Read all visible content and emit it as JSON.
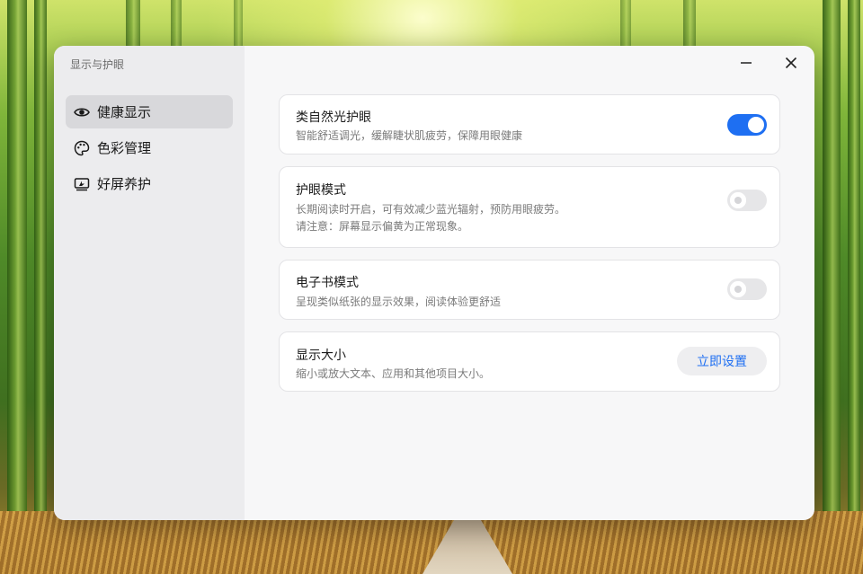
{
  "window": {
    "app_title": "显示与护眼"
  },
  "sidebar": {
    "items": [
      {
        "label": "健康显示",
        "icon": "eye-icon",
        "active": true
      },
      {
        "label": "色彩管理",
        "icon": "palette-icon",
        "active": false
      },
      {
        "label": "好屏养护",
        "icon": "screen-care-icon",
        "active": false
      }
    ]
  },
  "controls": {
    "minimize_icon": "minimize-icon",
    "close_icon": "close-icon"
  },
  "settings": {
    "natural_eye": {
      "title": "类自然光护眼",
      "desc": "智能舒适调光，缓解睫状肌疲劳，保障用眼健康",
      "enabled": true
    },
    "eye_mode": {
      "title": "护眼模式",
      "desc1": "长期阅读时开启，可有效减少蓝光辐射，预防用眼疲劳。",
      "desc2": "请注意：屏幕显示偏黄为正常现象。",
      "enabled": false
    },
    "ebook_mode": {
      "title": "电子书模式",
      "desc": "呈现类似纸张的显示效果，阅读体验更舒适",
      "enabled": false
    },
    "display_size": {
      "title": "显示大小",
      "desc": "缩小或放大文本、应用和其他项目大小。",
      "button": "立即设置"
    }
  },
  "colors": {
    "accent": "#1e6ff2",
    "window_bg": "#f7f7f8",
    "sidebar_bg": "#ececee"
  }
}
